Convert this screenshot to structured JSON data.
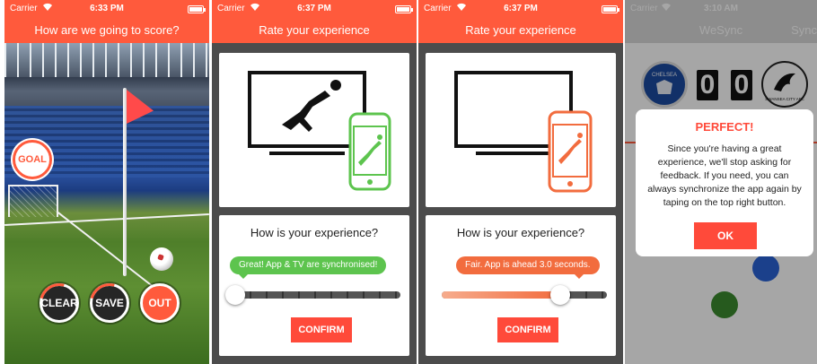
{
  "colors": {
    "accent": "#ff5a3c",
    "confirm": "#ff4a3a",
    "green": "#5dc44e",
    "orange": "#f26c3e",
    "panel_bg": "#4c4c4c"
  },
  "screen1": {
    "status": {
      "carrier": "Carrier",
      "time": "6:33 PM"
    },
    "title": "How are we going to score?",
    "goal_label": "GOAL",
    "buttons": {
      "clear": "CLEAR",
      "save": "SAVE",
      "out": "OUT"
    }
  },
  "screen2": {
    "status": {
      "carrier": "Carrier",
      "time": "6:37 PM"
    },
    "title": "Rate your experience",
    "question": "How is your experience?",
    "bubble": "Great! App & TV are synchronised!",
    "slider_value": 0.0,
    "confirm": "CONFIRM",
    "phone_color": "green"
  },
  "screen3": {
    "status": {
      "carrier": "Carrier",
      "time": "6:37 PM"
    },
    "title": "Rate your experience",
    "question": "How is your experience?",
    "bubble": "Fair. App is ahead 3.0 seconds.",
    "slider_value": 0.72,
    "confirm": "CONFIRM",
    "phone_color": "orange"
  },
  "screen4": {
    "status": {
      "carrier": "Carrier",
      "time": "3:10 AM"
    },
    "title": "WeSync",
    "title_right": "Sync",
    "home_crest": "CHELSEA",
    "away_crest": "SWANSEA CITY AFC",
    "score_home": "0",
    "score_away": "0",
    "modal": {
      "title": "PERFECT!",
      "body": "Since you're having a great experience, we'll stop asking for feedback. If you need, you can always synchronize the app again by taping on the top right button.",
      "ok": "OK"
    }
  }
}
